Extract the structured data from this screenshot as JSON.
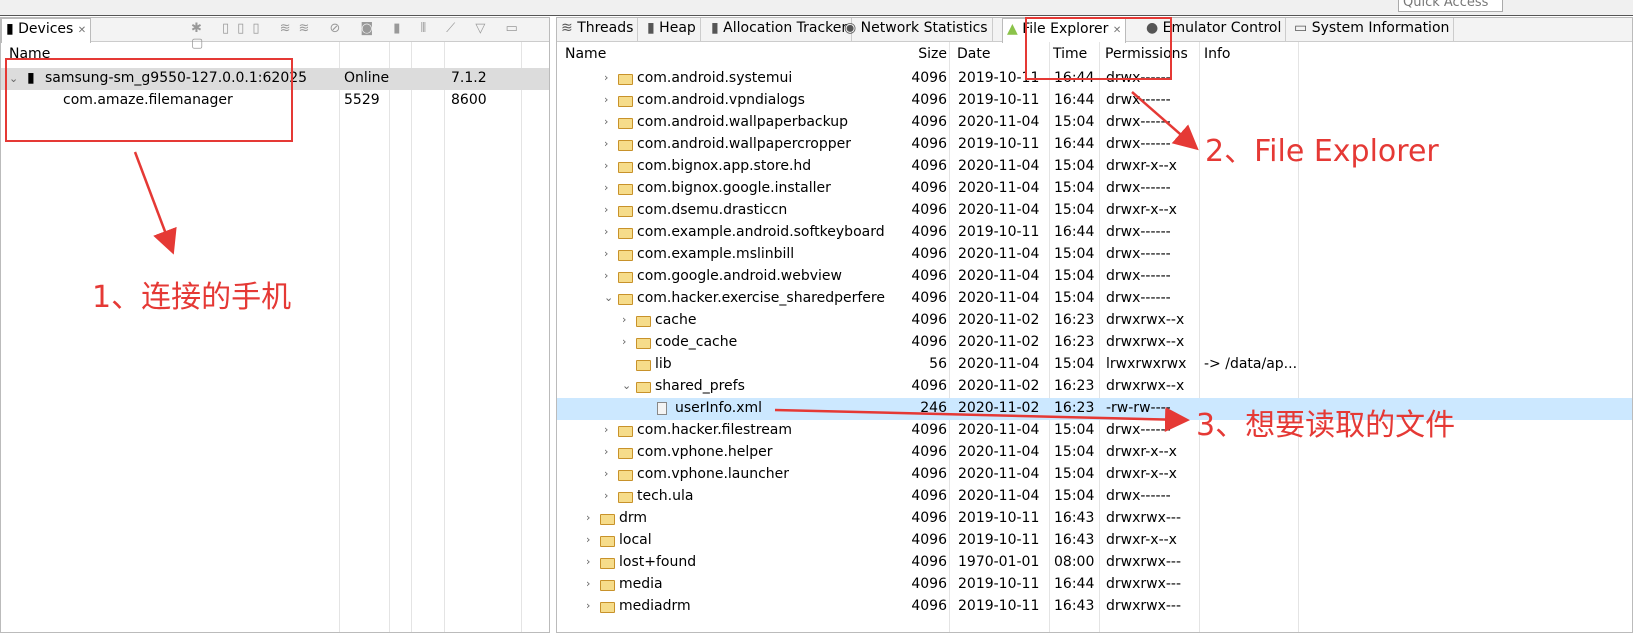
{
  "quick_access": "Quick Access",
  "devices": {
    "tab": "Devices",
    "header": "Name",
    "rows": [
      {
        "name": "samsung-sm_g9550-127.0.0.1:62025",
        "c2": "Online",
        "c3": "7.1.2",
        "level": 0,
        "selected": true
      },
      {
        "name": "com.amaze.filemanager",
        "c2": "5529",
        "c3": "8600",
        "level": 1
      }
    ]
  },
  "tabs": [
    "Threads",
    "Heap",
    "Allocation Tracker",
    "Network Statistics",
    "File Explorer",
    "Emulator Control",
    "System Information"
  ],
  "explorer": {
    "headers": {
      "name": "Name",
      "size": "Size",
      "date": "Date",
      "time": "Time",
      "perm": "Permissions",
      "info": "Info"
    },
    "rows": [
      {
        "n": "com.android.systemui",
        "s": "4096",
        "d": "2019-10-11",
        "t": "16:44",
        "p": "drwx------",
        "l": 1,
        "i": "",
        "c": ">"
      },
      {
        "n": "com.android.vpndialogs",
        "s": "4096",
        "d": "2019-10-11",
        "t": "16:44",
        "p": "drwx------",
        "l": 1,
        "i": "",
        "c": ">"
      },
      {
        "n": "com.android.wallpaperbackup",
        "s": "4096",
        "d": "2020-11-04",
        "t": "15:04",
        "p": "drwx------",
        "l": 1,
        "i": "",
        "c": ">"
      },
      {
        "n": "com.android.wallpapercropper",
        "s": "4096",
        "d": "2019-10-11",
        "t": "16:44",
        "p": "drwx------",
        "l": 1,
        "i": "",
        "c": ">"
      },
      {
        "n": "com.bignox.app.store.hd",
        "s": "4096",
        "d": "2020-11-04",
        "t": "15:04",
        "p": "drwxr-x--x",
        "l": 1,
        "i": "",
        "c": ">"
      },
      {
        "n": "com.bignox.google.installer",
        "s": "4096",
        "d": "2020-11-04",
        "t": "15:04",
        "p": "drwx------",
        "l": 1,
        "i": "",
        "c": ">"
      },
      {
        "n": "com.dsemu.drasticcn",
        "s": "4096",
        "d": "2020-11-04",
        "t": "15:04",
        "p": "drwxr-x--x",
        "l": 1,
        "i": "",
        "c": ">"
      },
      {
        "n": "com.example.android.softkeyboard",
        "s": "4096",
        "d": "2019-10-11",
        "t": "16:44",
        "p": "drwx------",
        "l": 1,
        "i": "",
        "c": ">"
      },
      {
        "n": "com.example.mslinbill",
        "s": "4096",
        "d": "2020-11-04",
        "t": "15:04",
        "p": "drwx------",
        "l": 1,
        "i": "",
        "c": ">"
      },
      {
        "n": "com.google.android.webview",
        "s": "4096",
        "d": "2020-11-04",
        "t": "15:04",
        "p": "drwx------",
        "l": 1,
        "i": "",
        "c": ">"
      },
      {
        "n": "com.hacker.exercise_sharedperfere",
        "s": "4096",
        "d": "2020-11-04",
        "t": "15:04",
        "p": "drwx------",
        "l": 1,
        "i": "",
        "c": "v"
      },
      {
        "n": "cache",
        "s": "4096",
        "d": "2020-11-02",
        "t": "16:23",
        "p": "drwxrwx--x",
        "l": 2,
        "i": "",
        "c": ">"
      },
      {
        "n": "code_cache",
        "s": "4096",
        "d": "2020-11-02",
        "t": "16:23",
        "p": "drwxrwx--x",
        "l": 2,
        "i": "",
        "c": ">"
      },
      {
        "n": "lib",
        "s": "56",
        "d": "2020-11-04",
        "t": "15:04",
        "p": "lrwxrwxrwx",
        "l": 2,
        "i": "-> /data/ap...",
        "c": ""
      },
      {
        "n": "shared_prefs",
        "s": "4096",
        "d": "2020-11-02",
        "t": "16:23",
        "p": "drwxrwx--x",
        "l": 2,
        "i": "",
        "c": "v"
      },
      {
        "n": "userInfo.xml",
        "s": "246",
        "d": "2020-11-02",
        "t": "16:23",
        "p": "-rw-rw----",
        "l": 3,
        "i": "",
        "c": "",
        "file": true,
        "sel": true
      },
      {
        "n": "com.hacker.filestream",
        "s": "4096",
        "d": "2020-11-04",
        "t": "15:04",
        "p": "drwx------",
        "l": 1,
        "i": "",
        "c": ">"
      },
      {
        "n": "com.vphone.helper",
        "s": "4096",
        "d": "2020-11-04",
        "t": "15:04",
        "p": "drwxr-x--x",
        "l": 1,
        "i": "",
        "c": ">"
      },
      {
        "n": "com.vphone.launcher",
        "s": "4096",
        "d": "2020-11-04",
        "t": "15:04",
        "p": "drwxr-x--x",
        "l": 1,
        "i": "",
        "c": ">"
      },
      {
        "n": "tech.ula",
        "s": "4096",
        "d": "2020-11-04",
        "t": "15:04",
        "p": "drwx------",
        "l": 1,
        "i": "",
        "c": ">"
      },
      {
        "n": "drm",
        "s": "4096",
        "d": "2019-10-11",
        "t": "16:43",
        "p": "drwxrwx---",
        "l": 0,
        "i": "",
        "c": ">"
      },
      {
        "n": "local",
        "s": "4096",
        "d": "2019-10-11",
        "t": "16:43",
        "p": "drwxr-x--x",
        "l": 0,
        "i": "",
        "c": ">"
      },
      {
        "n": "lost+found",
        "s": "4096",
        "d": "1970-01-01",
        "t": "08:00",
        "p": "drwxrwx---",
        "l": 0,
        "i": "",
        "c": ">"
      },
      {
        "n": "media",
        "s": "4096",
        "d": "2019-10-11",
        "t": "16:44",
        "p": "drwxrwx---",
        "l": 0,
        "i": "",
        "c": ">"
      },
      {
        "n": "mediadrm",
        "s": "4096",
        "d": "2019-10-11",
        "t": "16:43",
        "p": "drwxrwx---",
        "l": 0,
        "i": "",
        "c": ">"
      }
    ]
  },
  "annotations": [
    "1、连接的手机",
    "2、File Explorer",
    "3、想要读取的文件"
  ],
  "colors": {
    "annotation": "#e53935",
    "selection": "#cce8ff",
    "device_row": "#dcdcdc"
  }
}
